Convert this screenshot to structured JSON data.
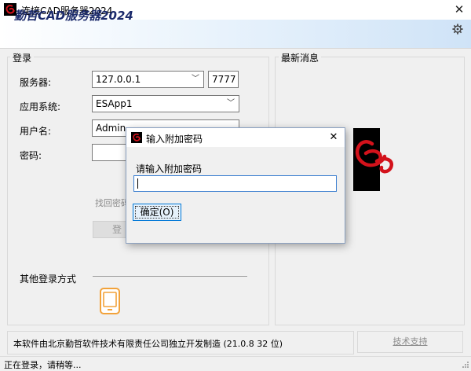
{
  "window": {
    "title": "连接CAD服务器2024",
    "close_glyph": "✕"
  },
  "banner": {
    "title": "勤哲CAD服务器2024",
    "settings_icon": "gear-icon"
  },
  "login": {
    "group_title": "登录",
    "server_label": "服务器:",
    "server_value": "127.0.0.1",
    "port_value": "7777",
    "app_label": "应用系统:",
    "app_value": "ESApp1",
    "user_label": "用户名:",
    "user_value": "Admin",
    "password_label": "密码:",
    "forgot_text": "找回密码",
    "login_button": "登",
    "other_login_label": "其他登录方式",
    "phone_icon": "mobile-phone-icon"
  },
  "news": {
    "group_title": "最新消息"
  },
  "footer": {
    "text": "本软件由北京勤哲软件技术有限责任公司独立开发制造 (21.0.8 32 位)",
    "support_button": "技术支持"
  },
  "status": {
    "text": "正在登录，请稍等..."
  },
  "dialog": {
    "title": "输入附加密码",
    "close_glyph": "✕",
    "prompt": "请输入附加密码",
    "input_value": "",
    "ok_button": "确定(O)"
  },
  "colors": {
    "brand_red": "#d3121b",
    "banner_blue": "#1b2a6b",
    "phone_orange": "#f2a23a",
    "focus_blue": "#0078d7"
  }
}
